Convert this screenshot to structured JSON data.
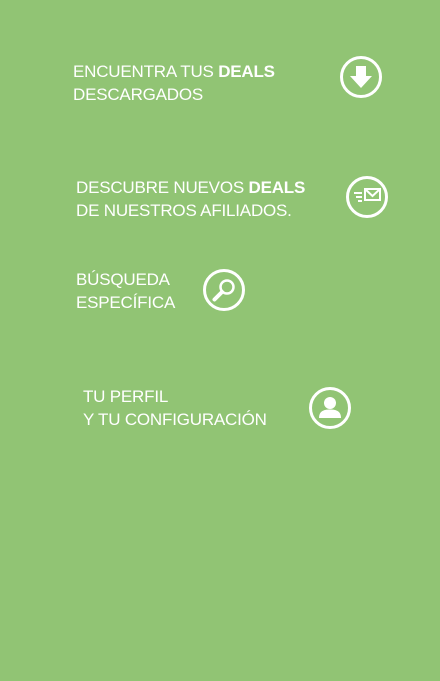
{
  "tips": {
    "downloads": {
      "line1_pre": "ENCUENTRA TUS ",
      "line1_bold": "DEALS",
      "line2": "DESCARGADOS",
      "icon": "download-arrow-icon"
    },
    "discover": {
      "line1_pre": "DESCUBRE NUEVOS ",
      "line1_bold": "DEALS",
      "line2": "DE NUESTROS AFILIADOS.",
      "icon": "fast-mail-icon"
    },
    "search": {
      "line1": "BÚSQUEDA",
      "line2": "ESPECÍFICA",
      "icon": "magnifier-icon"
    },
    "profile": {
      "line1": "TU PERFIL",
      "line2": "Y TU CONFIGURACIÓN",
      "icon": "user-profile-icon"
    }
  },
  "colors": {
    "background": "#91c474",
    "foreground": "#ffffff"
  }
}
